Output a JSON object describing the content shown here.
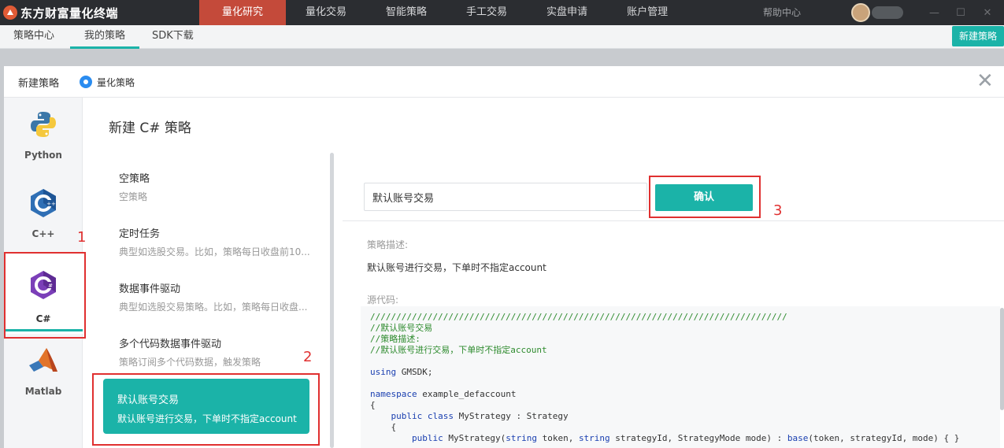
{
  "app": {
    "title": "东方财富量化终端"
  },
  "main_nav": [
    "量化研究",
    "量化交易",
    "智能策略",
    "手工交易",
    "实盘申请",
    "账户管理"
  ],
  "help_label": "帮助中心",
  "window_controls": [
    "—",
    "☐",
    "✕"
  ],
  "sub_tabs": [
    "策略中心",
    "我的策略",
    "SDK下载"
  ],
  "new_strategy_button": "新建策略",
  "dialog": {
    "title": "新建策略",
    "radio_label": "量化策略",
    "close": "✕"
  },
  "languages": [
    {
      "label": "Python",
      "icon": "python-icon"
    },
    {
      "label": "C++",
      "icon": "cpp-icon"
    },
    {
      "label": "C#",
      "icon": "csharp-icon",
      "active": true
    },
    {
      "label": "Matlab",
      "icon": "matlab-icon"
    }
  ],
  "templates_title": "新建 C# 策略",
  "templates": [
    {
      "title": "空策略",
      "desc": "空策略"
    },
    {
      "title": "定时任务",
      "desc": "典型如选股交易。比如，策略每日收盘前10..."
    },
    {
      "title": "数据事件驱动",
      "desc": "典型如选股交易策略。比如，策略每日收盘..."
    },
    {
      "title": "多个代码数据事件驱动",
      "desc": "策略订阅多个代码数据，触发策略"
    },
    {
      "title": "默认账号交易",
      "desc": "默认账号进行交易，下单时不指定account",
      "selected": true
    }
  ],
  "strategy_name_value": "默认账号交易",
  "confirm_label": "确认",
  "desc_label": "策略描述:",
  "desc_text": "默认账号进行交易，下单时不指定account",
  "code_label": "源代码:",
  "code_lines": {
    "l1": "////////////////////////////////////////////////////////////////////////////////",
    "l2": "//默认账号交易",
    "l3": "//策略描述:",
    "l4": "//默认账号进行交易，下单时不指定account",
    "l6a": "using",
    "l6b": " GMSDK;",
    "l8a": "namespace",
    "l8b": " example_defaccount",
    "l9": "{",
    "l10a": "    public class",
    "l10b": " MyStrategy : Strategy",
    "l11": "    {",
    "l12a": "        public",
    "l12b": " MyStrategy(",
    "l12c": "string",
    "l12d": " token, ",
    "l12e": "string",
    "l12f": " strategyId, StrategyMode mode) : ",
    "l12g": "base",
    "l12h": "(token, strategyId, mode) { }"
  },
  "annotations": [
    "1",
    "2",
    "3"
  ]
}
